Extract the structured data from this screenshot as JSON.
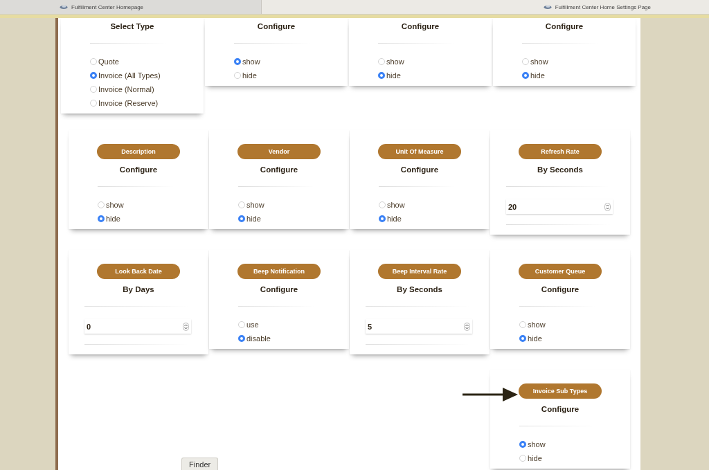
{
  "browser_tabs": [
    {
      "title": "Fulfillment Center Homepage",
      "selected": false
    },
    {
      "title": "Fulfillment Center Home Settings Page",
      "selected": true
    }
  ],
  "rows": [
    {
      "cards": [
        {
          "heading": "Select Type",
          "highlighted": false,
          "control": {
            "kind": "radio",
            "options": [
              {
                "label": "Quote",
                "selected": false
              },
              {
                "label": "Invoice (All Types)",
                "selected": true
              },
              {
                "label": "Invoice (Normal)",
                "selected": false
              },
              {
                "label": "Invoice (Reserve)",
                "selected": false
              }
            ]
          }
        },
        {
          "heading": "Configure",
          "highlighted": false,
          "control": {
            "kind": "radio",
            "options": [
              {
                "label": "show",
                "selected": true
              },
              {
                "label": "hide",
                "selected": false
              }
            ]
          }
        },
        {
          "heading": "Configure",
          "highlighted": false,
          "control": {
            "kind": "radio",
            "options": [
              {
                "label": "show",
                "selected": false
              },
              {
                "label": "hide",
                "selected": true
              }
            ]
          }
        },
        {
          "heading": "Configure",
          "highlighted": false,
          "control": {
            "kind": "radio",
            "options": [
              {
                "label": "show",
                "selected": false
              },
              {
                "label": "hide",
                "selected": true
              }
            ]
          }
        }
      ]
    },
    {
      "cards": [
        {
          "pill": "Description",
          "heading": "Configure",
          "highlighted": false,
          "control": {
            "kind": "radio",
            "options": [
              {
                "label": "show",
                "selected": false
              },
              {
                "label": "hide",
                "selected": true
              }
            ]
          }
        },
        {
          "pill": "Vendor",
          "heading": "Configure",
          "highlighted": false,
          "control": {
            "kind": "radio",
            "options": [
              {
                "label": "show",
                "selected": false
              },
              {
                "label": "hide",
                "selected": true
              }
            ]
          }
        },
        {
          "pill": "Unit Of Measure",
          "heading": "Configure",
          "highlighted": false,
          "control": {
            "kind": "radio",
            "options": [
              {
                "label": "show",
                "selected": false
              },
              {
                "label": "hide",
                "selected": true
              }
            ]
          }
        },
        {
          "pill": "Refresh Rate",
          "heading": "By Seconds",
          "highlighted": false,
          "control": {
            "kind": "number",
            "value": "20"
          }
        }
      ]
    },
    {
      "cards": [
        {
          "pill": "Look Back Date",
          "heading": "By Days",
          "highlighted": false,
          "control": {
            "kind": "number",
            "value": "0"
          }
        },
        {
          "pill": "Beep Notification",
          "heading": "Configure",
          "highlighted": false,
          "control": {
            "kind": "radio",
            "options": [
              {
                "label": "use",
                "selected": false
              },
              {
                "label": "disable",
                "selected": true
              }
            ]
          }
        },
        {
          "pill": "Beep Interval Rate",
          "heading": "By Seconds",
          "highlighted": false,
          "control": {
            "kind": "number",
            "value": "5"
          }
        },
        {
          "pill": "Customer Queue",
          "heading": "Configure",
          "highlighted": false,
          "control": {
            "kind": "radio",
            "options": [
              {
                "label": "show",
                "selected": false
              },
              {
                "label": "hide",
                "selected": true
              }
            ]
          }
        }
      ]
    },
    {
      "cards": [
        {
          "pill": "Invoice Sub Types",
          "heading": "Configure",
          "highlighted": true,
          "control": {
            "kind": "radio",
            "options": [
              {
                "label": "show",
                "selected": true
              },
              {
                "label": "hide",
                "selected": false
              }
            ]
          }
        }
      ]
    }
  ],
  "finder_tooltip": "Finder"
}
